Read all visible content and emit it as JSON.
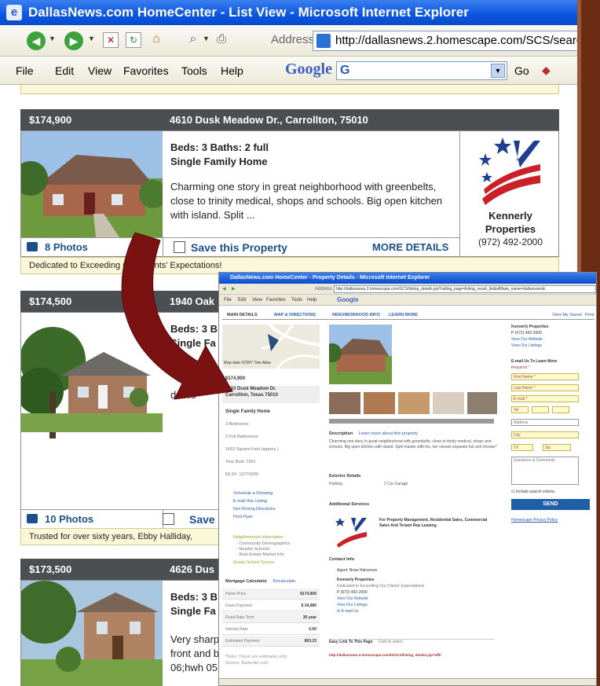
{
  "window": {
    "title": "DallasNews.com HomeCenter - List View - Microsoft Internet Explorer"
  },
  "toolbar": {
    "address_label": "Address",
    "address_value": "http://dallasnews.2.homescape.com/SCS/search.jsp"
  },
  "menu": {
    "items": [
      "File",
      "Edit",
      "View",
      "Favorites",
      "Tools",
      "Help"
    ],
    "google_label": "Google",
    "google_field": "G",
    "go_label": "Go"
  },
  "listings": [
    {
      "price": "$174,900",
      "address": "4610 Dusk Meadow Dr., Carrollton, 75010",
      "beds_baths": "Beds: 3  Baths: 2 full",
      "type": "Single Family Home",
      "description": "Charming one story in great neighborhood with greenbelts, close to trinity medical, shops and schools. Big open kitchen with island. Split ...",
      "photos": "8 Photos",
      "save": "Save this Property",
      "more": "MORE DETAILS",
      "tagline": "Dedicated to Exceeding Our Clients' Expectations!",
      "agent_name": "Kennerly",
      "agent_name2": "Properties",
      "agent_phone": "(972) 492-2000"
    },
    {
      "price": "$174,500",
      "address": "1940 Oak",
      "beds_baths": "Beds: 3 B",
      "type": "Single Fa",
      "description": "Clean a",
      "description2": "doors",
      "photos": "10 Photos",
      "save": "Save t",
      "tagline": "Trusted for over sixty years, Ebby Halliday,"
    },
    {
      "price": "$173,500",
      "address": "4626 Dus",
      "beds_baths": "Beds: 3 B",
      "type": "Single Fa",
      "d1": "Very sharp",
      "d2": "front and b",
      "d3": "06;hwh 05"
    }
  ],
  "inset": {
    "title": "DallasNews.com HomeCenter - Property Details - Microsoft Internet Explorer",
    "address_label": "Address",
    "address_value": "http://dallasnews.2.homescape.com/SCS/listing_details.jsp?calling_page=listing_result_list&affiliate_name=dallasnews&",
    "menu_items": [
      "File",
      "Edit",
      "View",
      "Favorites",
      "Tools",
      "Help"
    ],
    "google_label": "Google",
    "tabs": [
      "MAIN DETAILS",
      "MAP & DIRECTIONS",
      "NEIGHBORHOOD INFO",
      "LEARN MORE"
    ],
    "view_saved": "View My Saved",
    "print": "Print",
    "map_credit": "Map data ©2007 Tele Atlas",
    "price": "$174,900",
    "street": "4610 Dusk Meadow Dr.",
    "city": "Carrollton, Texas 75010",
    "type": "Single Family Home",
    "facts": [
      "3 Bedrooms",
      "2 Full Bathrooms",
      "1662 Square Feet (approx.)",
      "Year Built: 1991",
      "MLS#: 10770930"
    ],
    "actions": [
      "Schedule a Showing",
      "E-mail this Listing",
      "Get Driving Directions",
      "Print Flyer"
    ],
    "neighborhood": [
      "Neighborhood Information",
      "- Community Demographics",
      "- Nearby Schools",
      "- Real Estate Market Info",
      "Grade School Scores"
    ],
    "calc_title": "Mortgage Calculator",
    "recalc": "Recalculate",
    "calc_rows": [
      [
        "Home Price",
        "$174,900"
      ],
      [
        "Down Payment",
        "$ 34,980"
      ],
      [
        "Fixed Rate Term",
        "30 year"
      ],
      [
        "Interest Rate",
        "5.60"
      ],
      [
        "Estimated Payment",
        "803.23"
      ]
    ],
    "calc_note": "*Note: These are estimates only.",
    "calc_source": "Source: Bankrate.com",
    "desc_label": "Description",
    "desc_link": "Learn more about this property",
    "desc_text": "Charming one story in great neighborhood with greenbelts, close to trinity medical, shops and schools. Big open kitchen with island. Split master with his, her closets separate tub and shower*",
    "exterior_label": "Exterior Details",
    "parking_label": "Parking",
    "parking_value": "2 Car Garage",
    "services_label": "Additional Services",
    "services_text": "For Property Management, Residential Sales, Commercial Sales And Tenant Rep Leasing.",
    "contact_label": "Contact Info",
    "agent": "Agent: Brian Halverson",
    "company": "Kennerly Properties",
    "slogan": "Dedicated to Exceeding Our Clients' Expectations!",
    "phone": "P (972) 492-2000",
    "website": "View Our Website",
    "listings_link": "View Our Listings",
    "email_us": "E-mail Us",
    "easy_link": "Easy Link To This Page",
    "click_select": "Click to select",
    "easy_url": "http://dallasnews.2.homescape.com/IS/SCS/listing_details.jsp?affil",
    "r_company": "Kennerly Properties",
    "r_phone": "P (972) 492-2000",
    "r_website": "View Our Website",
    "r_listings": "View Our Listings",
    "email_learn": "E-mail Us To Learn More",
    "required": "Required *",
    "fields": [
      "First Name *",
      "Last Name *",
      "E-mail *",
      "Tel",
      "Address",
      "City",
      "TX",
      "Zip",
      "Questions & Comments"
    ],
    "include": "Include search criteria",
    "send": "SEND",
    "privacy": "Homescape Privacy Policy"
  },
  "colors": {
    "bar": "#4b4f52",
    "link": "#1c4f8c",
    "arrow": "#7a1212",
    "frame": "#6b2c14"
  }
}
